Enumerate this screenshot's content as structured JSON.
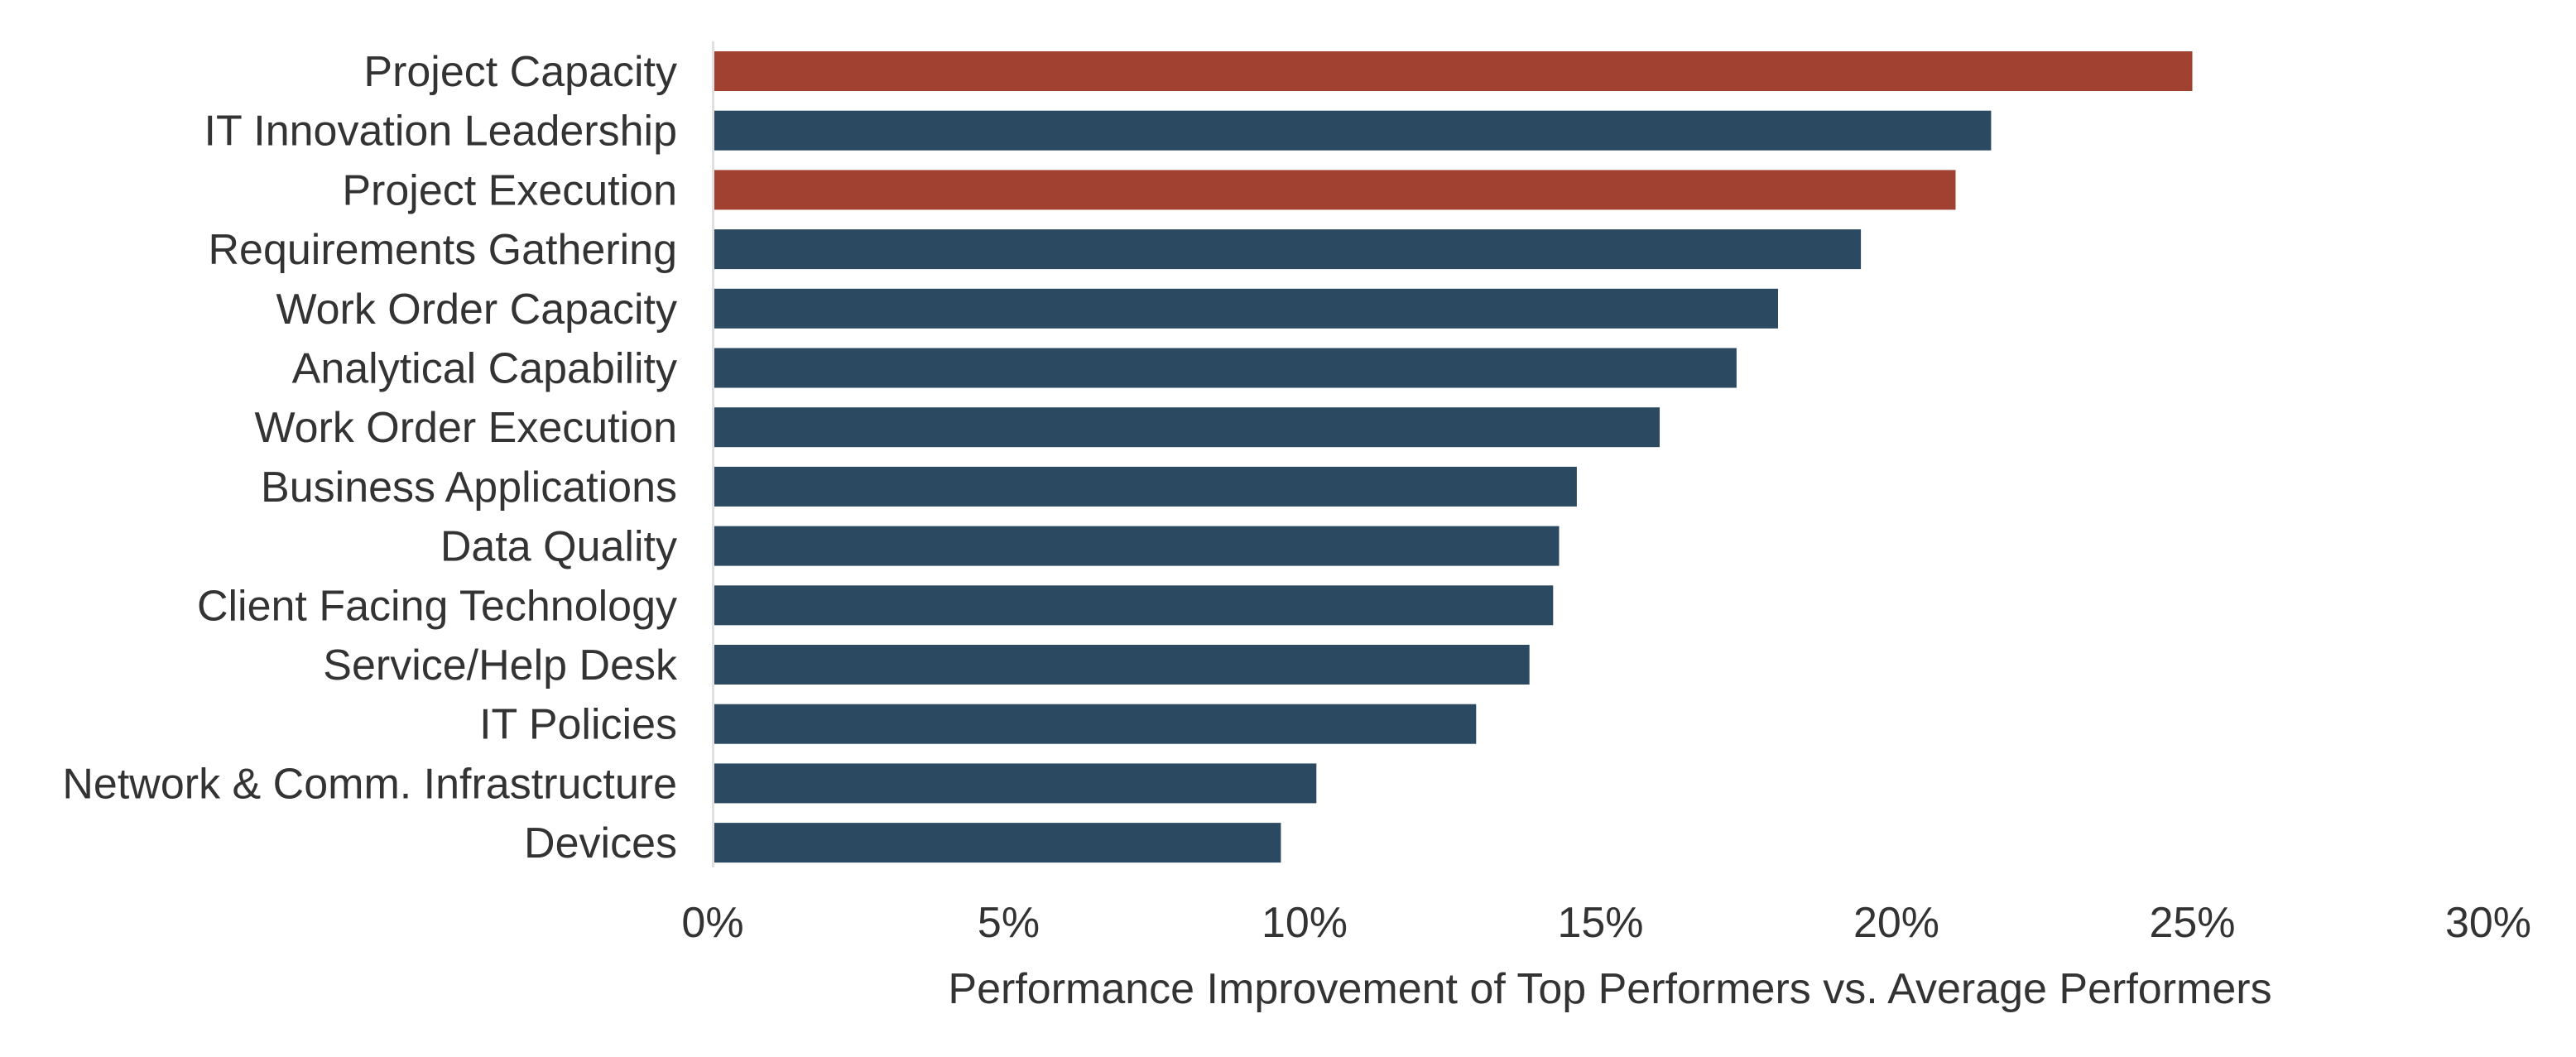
{
  "chart_data": {
    "type": "bar",
    "orientation": "horizontal",
    "title": "",
    "xlabel": "Performance Improvement of Top Performers vs. Average Performers",
    "ylabel": "",
    "xlim": [
      0,
      30
    ],
    "x_ticks": [
      0,
      5,
      10,
      15,
      20,
      25,
      30
    ],
    "x_tick_labels": [
      "0%",
      "5%",
      "10%",
      "15%",
      "20%",
      "25%",
      "30%"
    ],
    "grid": false,
    "legend": "none",
    "categories": [
      "Project Capacity",
      "IT Innovation Leadership",
      "Project Execution",
      "Requirements Gathering",
      "Work Order Capacity",
      "Analytical Capability",
      "Work Order Execution",
      "Business Applications",
      "Data Quality",
      "Client Facing Technology",
      "Service/Help Desk",
      "IT Policies",
      "Network & Comm. Infrastructure",
      "Devices"
    ],
    "values": [
      25.0,
      21.6,
      21.0,
      19.4,
      18.0,
      17.3,
      16.0,
      14.6,
      14.3,
      14.2,
      13.8,
      12.9,
      10.2,
      9.6
    ],
    "highlighted": [
      true,
      false,
      true,
      false,
      false,
      false,
      false,
      false,
      false,
      false,
      false,
      false,
      false,
      false
    ],
    "unit": "%"
  },
  "colors": {
    "highlight": "#a14132",
    "default": "#2b4961",
    "axis": "#e0e0e0",
    "text": "#333333"
  }
}
